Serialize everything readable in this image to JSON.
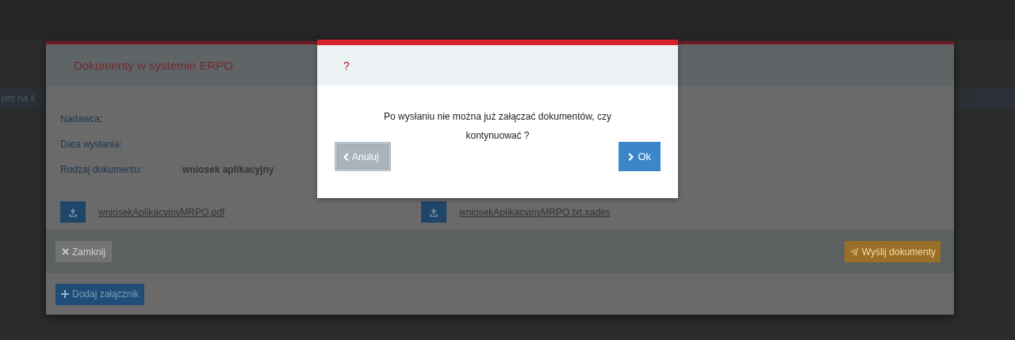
{
  "page": {
    "partial_text": "um na li"
  },
  "documents_modal": {
    "title": "Dokumenty w systemie ERPO",
    "fields": [
      {
        "label": "Nadawca:"
      },
      {
        "label": "Data wysłania:"
      },
      {
        "label": "Rodzaj dokumentu:",
        "value": "wniosek aplikacyjny"
      }
    ],
    "files": [
      {
        "name": "wniosekAplikacyjnyMRPO.pdf"
      },
      {
        "name": "wniosekAplikacyjnyMRPO.txt.xades"
      }
    ],
    "close_button": "Zamknij",
    "send_button": "Wyślij dokumenty",
    "add_button": "Dodaj załącznik"
  },
  "confirm_dialog": {
    "title": "?",
    "message": "Po wysłaniu nie można już załączać dokumentów, czy kontynuować ?",
    "cancel_button": "Anuluj",
    "ok_button": "Ok"
  }
}
